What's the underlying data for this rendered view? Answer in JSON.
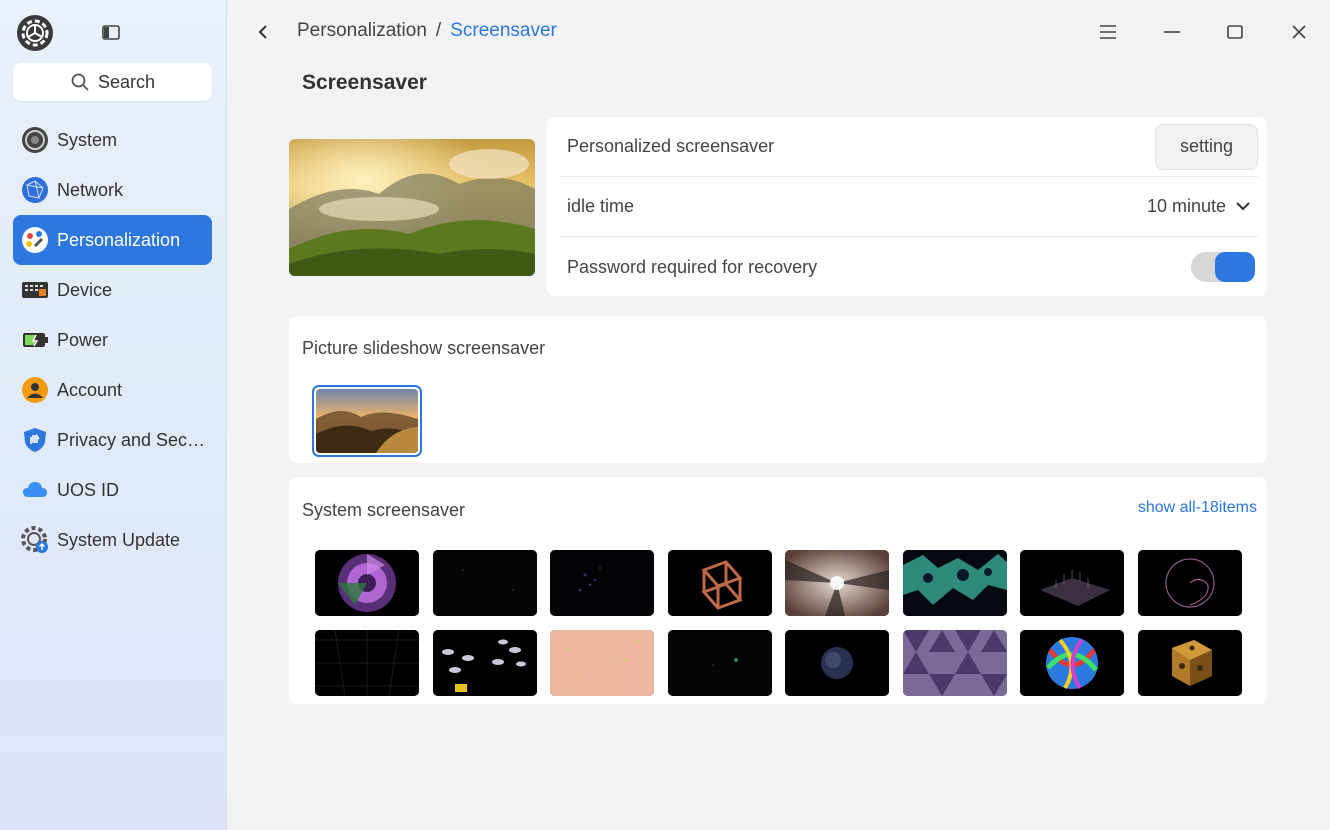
{
  "sidebar": {
    "search": {
      "label": "Search"
    },
    "items": [
      {
        "label": "System",
        "icon": "system-icon"
      },
      {
        "label": "Network",
        "icon": "network-icon"
      },
      {
        "label": "Personalization",
        "icon": "personalization-icon",
        "active": true
      },
      {
        "label": "Device",
        "icon": "device-icon"
      },
      {
        "label": "Power",
        "icon": "power-icon"
      },
      {
        "label": "Account",
        "icon": "account-icon"
      },
      {
        "label": "Privacy and Sec…",
        "icon": "privacy-shield-icon"
      },
      {
        "label": "UOS ID",
        "icon": "cloud-icon"
      },
      {
        "label": "System Update",
        "icon": "system-update-icon"
      }
    ]
  },
  "breadcrumb": {
    "parent": "Personalization",
    "separator": "/",
    "current": "Screensaver"
  },
  "page": {
    "title": "Screensaver"
  },
  "settings": {
    "personalized": {
      "label": "Personalized screensaver",
      "button": "setting"
    },
    "idle": {
      "label": "idle time",
      "value": "10 minute"
    },
    "password": {
      "label": "Password required for recovery",
      "enabled": true
    }
  },
  "slideshow": {
    "title": "Picture slideshow screensaver"
  },
  "system_screensaver": {
    "title": "System screensaver",
    "show_all": "show all-18items"
  },
  "colors": {
    "accent": "#2c77e0"
  }
}
